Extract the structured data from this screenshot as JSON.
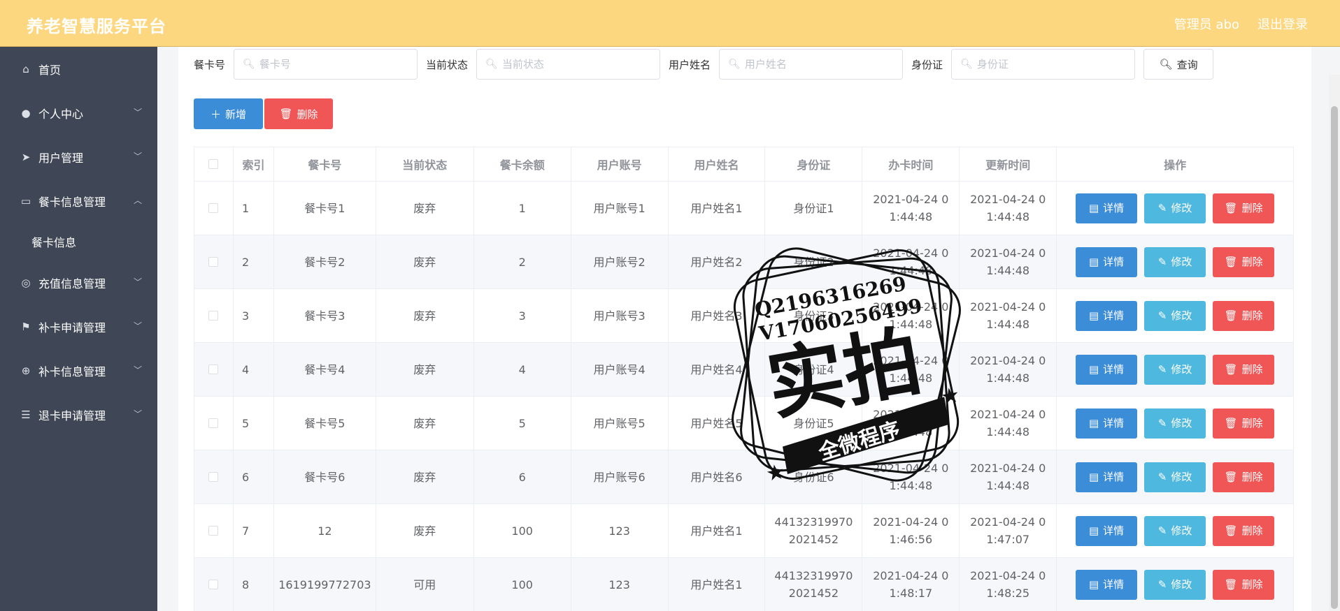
{
  "header": {
    "title": "养老智慧服务平台",
    "user": "管理员 abo",
    "logout": "退出登录"
  },
  "colors": {
    "header": "#fdd77f",
    "sidebar": "#3f4756",
    "primary": "#3c8dd7",
    "danger": "#f05656",
    "edit": "#4fb8de"
  },
  "sidebar": {
    "items": [
      {
        "label": "首页",
        "icon": "home-icon"
      },
      {
        "label": "个人中心",
        "icon": "user-icon",
        "expandable": true
      },
      {
        "label": "用户管理",
        "icon": "send-icon",
        "expandable": true
      },
      {
        "label": "餐卡信息管理",
        "icon": "card-icon",
        "expandable": true,
        "expanded": true
      },
      {
        "label": "充值信息管理",
        "icon": "compass-icon",
        "expandable": true
      },
      {
        "label": "补卡申请管理",
        "icon": "flag-icon",
        "expandable": true
      },
      {
        "label": "补卡信息管理",
        "icon": "globe-icon",
        "expandable": true
      },
      {
        "label": "退卡申请管理",
        "icon": "sliders-icon",
        "expandable": true
      }
    ],
    "sub_item": "餐卡信息"
  },
  "search": {
    "fields": [
      {
        "label": "餐卡号",
        "placeholder": "餐卡号"
      },
      {
        "label": "当前状态",
        "placeholder": "当前状态"
      },
      {
        "label": "用户姓名",
        "placeholder": "用户姓名"
      },
      {
        "label": "身份证",
        "placeholder": "身份证"
      }
    ],
    "query_label": "查询"
  },
  "actions": {
    "add": "新增",
    "delete": "删除"
  },
  "table": {
    "headers": [
      "索引",
      "餐卡号",
      "当前状态",
      "餐卡余额",
      "用户账号",
      "用户姓名",
      "身份证",
      "办卡时间",
      "更新时间",
      "操作"
    ],
    "op_labels": {
      "detail": "详情",
      "edit": "修改",
      "delete": "删除"
    },
    "rows": [
      [
        "1",
        "餐卡号1",
        "废弃",
        "1",
        "用户账号1",
        "用户姓名1",
        "身份证1",
        "2021-04-24 01:44:48",
        "2021-04-24 01:44:48"
      ],
      [
        "2",
        "餐卡号2",
        "废弃",
        "2",
        "用户账号2",
        "用户姓名2",
        "身份证2",
        "2021-04-24 01:44:48",
        "2021-04-24 01:44:48"
      ],
      [
        "3",
        "餐卡号3",
        "废弃",
        "3",
        "用户账号3",
        "用户姓名3",
        "身份证3",
        "2021-04-24 01:44:48",
        "2021-04-24 01:44:48"
      ],
      [
        "4",
        "餐卡号4",
        "废弃",
        "4",
        "用户账号4",
        "用户姓名4",
        "身份证4",
        "2021-04-24 01:44:48",
        "2021-04-24 01:44:48"
      ],
      [
        "5",
        "餐卡号5",
        "废弃",
        "5",
        "用户账号5",
        "用户姓名5",
        "身份证5",
        "2021-04-24 01:44:48",
        "2021-04-24 01:44:48"
      ],
      [
        "6",
        "餐卡号6",
        "废弃",
        "6",
        "用户账号6",
        "用户姓名6",
        "身份证6",
        "2021-04-24 01:44:48",
        "2021-04-24 01:44:48"
      ],
      [
        "7",
        "12",
        "废弃",
        "100",
        "123",
        "用户姓名1",
        "441323199702021452",
        "2021-04-24 01:46:56",
        "2021-04-24 01:47:07"
      ],
      [
        "8",
        "1619199772703",
        "可用",
        "100",
        "123",
        "用户姓名1",
        "441323199702021452",
        "2021-04-24 01:48:17",
        "2021-04-24 01:48:25"
      ]
    ]
  },
  "watermark": {
    "line1": "Q2196316269",
    "line2": "V17060256499",
    "main": "实拍",
    "banner": "全微程序"
  }
}
